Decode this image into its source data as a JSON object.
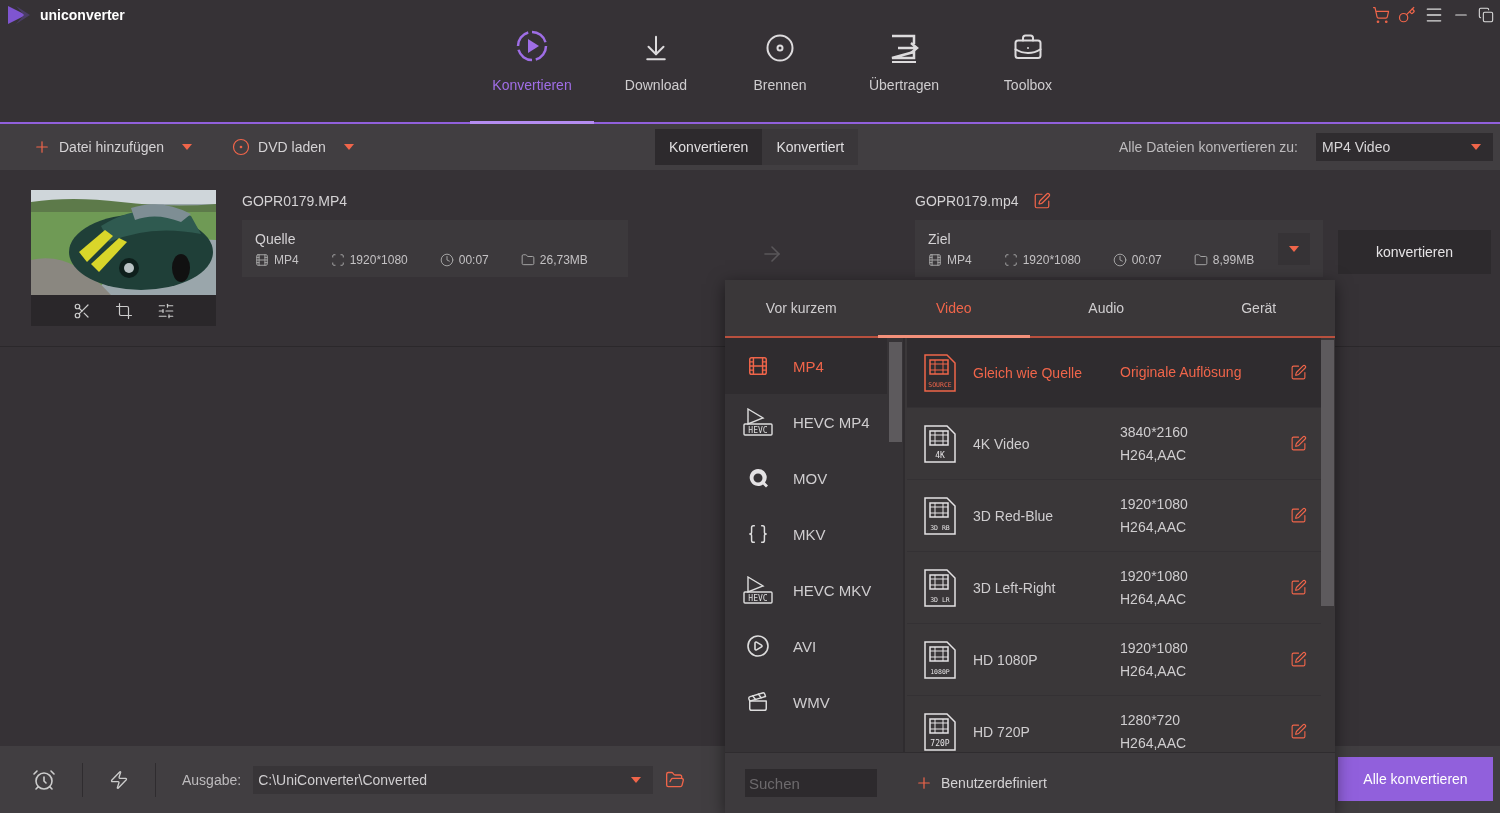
{
  "app": {
    "title": "uniconverter"
  },
  "nav": [
    {
      "label": "Konvertieren",
      "selected": true
    },
    {
      "label": "Download",
      "selected": false
    },
    {
      "label": "Brennen",
      "selected": false
    },
    {
      "label": "Übertragen",
      "selected": false
    },
    {
      "label": "Toolbox",
      "selected": false
    }
  ],
  "toolbar": {
    "add_file": "Datei hinzufügen",
    "load_dvd": "DVD laden",
    "tabs": [
      {
        "label": "Konvertieren",
        "selected": true
      },
      {
        "label": "Konvertiert",
        "selected": false
      }
    ],
    "convert_all_label": "Alle Dateien konvertieren zu:",
    "target_format": "MP4 Video"
  },
  "file": {
    "source_name": "GOPR0179.MP4",
    "source": {
      "title": "Quelle",
      "format": "MP4",
      "resolution": "1920*1080",
      "duration": "00:07",
      "size": "26,73MB"
    },
    "target_name": "GOPR0179.mp4",
    "target": {
      "title": "Ziel",
      "format": "MP4",
      "resolution": "1920*1080",
      "duration": "00:07",
      "size": "8,99MB"
    },
    "convert_button": "konvertieren"
  },
  "format_popup": {
    "tabs": [
      {
        "label": "Vor kurzem",
        "selected": false
      },
      {
        "label": "Video",
        "selected": true
      },
      {
        "label": "Audio",
        "selected": false
      },
      {
        "label": "Gerät",
        "selected": false
      }
    ],
    "formats": [
      {
        "label": "MP4",
        "selected": true
      },
      {
        "label": "HEVC MP4",
        "badge": "HEVC",
        "selected": false
      },
      {
        "label": "MOV",
        "selected": false
      },
      {
        "label": "MKV",
        "selected": false
      },
      {
        "label": "HEVC MKV",
        "badge": "HEVC",
        "selected": false
      },
      {
        "label": "AVI",
        "selected": false
      },
      {
        "label": "WMV",
        "selected": false
      }
    ],
    "presets": [
      {
        "kind": "source",
        "name": "Gleich wie Quelle",
        "badge": "SOURCE",
        "detail": "Originale Auflösung",
        "selected": true
      },
      {
        "kind": "preset",
        "name": "4K Video",
        "badge": "4K",
        "resolution": "3840*2160",
        "codec": "H264,AAC",
        "selected": false
      },
      {
        "kind": "preset",
        "name": "3D Red-Blue",
        "badge": "3D RB",
        "resolution": "1920*1080",
        "codec": "H264,AAC",
        "selected": false
      },
      {
        "kind": "preset",
        "name": "3D Left-Right",
        "badge": "3D LR",
        "resolution": "1920*1080",
        "codec": "H264,AAC",
        "selected": false
      },
      {
        "kind": "preset",
        "name": "HD 1080P",
        "badge": "1080P",
        "resolution": "1920*1080",
        "codec": "H264,AAC",
        "selected": false
      },
      {
        "kind": "preset",
        "name": "HD 720P",
        "badge": "720P",
        "resolution": "1280*720",
        "codec": "H264,AAC",
        "selected": false
      }
    ],
    "search_placeholder": "Suchen",
    "custom": "Benutzerdefiniert"
  },
  "bottom": {
    "output_label": "Ausgabe:",
    "output_path": "C:\\UniConverter\\Converted",
    "convert_all": "Alle konvertieren"
  }
}
